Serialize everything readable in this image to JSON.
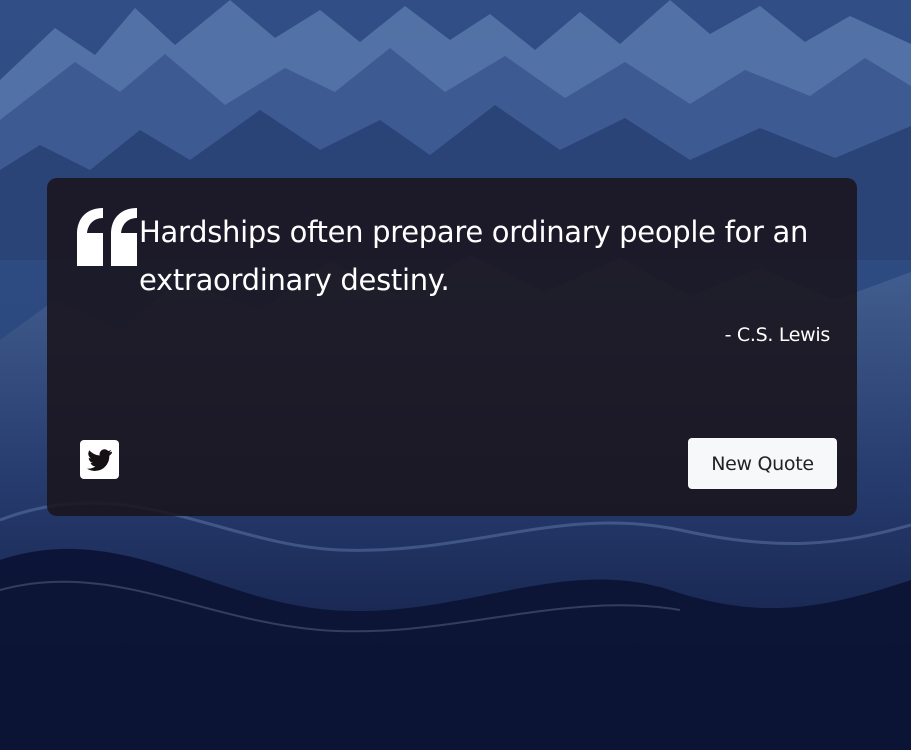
{
  "background": {
    "icon": "mountain-landscape",
    "colors": {
      "sky": "#3f5d92",
      "peaks": "#6f8fc4",
      "shadow": "#121a38"
    }
  },
  "quote": {
    "text": "Hardships often prepare ordinary people for an extraordinary destiny.",
    "author": "- C.S. Lewis",
    "icon": "quote-left-icon"
  },
  "actions": {
    "tweet_icon": "twitter-icon",
    "new_quote_label": "New Quote"
  },
  "colors": {
    "card": "#1a141c",
    "text": "#ffffff",
    "button": "#f7f8fa",
    "button_text": "#222222"
  }
}
